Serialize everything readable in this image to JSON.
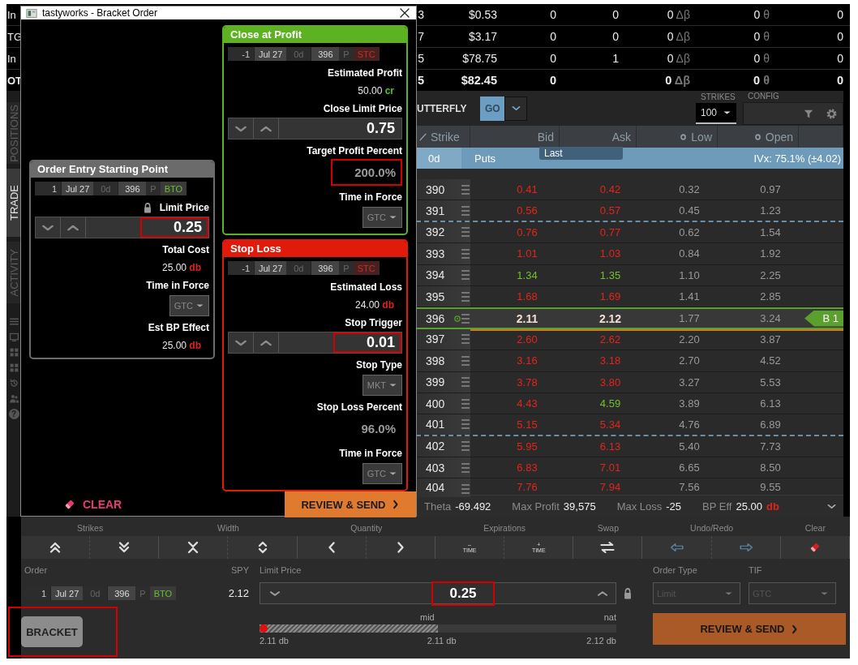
{
  "positions_table": {
    "rows": [
      {
        "column_1": "In",
        "column_2": "3",
        "price": "$0.53",
        "trades": "0",
        "counter": "0",
        "beta_delta": "0",
        "beta_symbol": "Δβ",
        "theta": "0",
        "theta_symbol": "θ",
        "last": "0",
        "total": false
      },
      {
        "column_1": "TG",
        "column_2": "7",
        "price": "$3.17",
        "trades": "0",
        "counter": "0",
        "beta_delta": "0",
        "beta_symbol": "Δβ",
        "theta": "0",
        "theta_symbol": "θ",
        "last": "0",
        "total": false
      },
      {
        "column_1": "In",
        "column_2": "5",
        "price": "$78.75",
        "trades": "0",
        "counter": "1",
        "beta_delta": "0",
        "beta_symbol": "Δβ",
        "theta": "0",
        "theta_symbol": "θ",
        "last": "0",
        "total": false
      },
      {
        "column_1": "OT",
        "column_2": "5",
        "price": "$82.45",
        "trades": "0",
        "beta_delta": "0",
        "beta_symbol": "Δβ",
        "theta": "0",
        "theta_symbol": "θ",
        "last": "0",
        "total": true
      }
    ]
  },
  "sidebar": {
    "tabs": [
      {
        "label": "POSITIONS",
        "selected": false
      },
      {
        "label": "TRADE",
        "selected": true
      },
      {
        "label": "ACTIVITY",
        "selected": false
      }
    ],
    "help": "?"
  },
  "toolbar": {
    "strategy": "UTTERFLY",
    "go": "GO",
    "strikes_label": "STRIKES",
    "strikes_value": "100",
    "config_label": "CONFIG"
  },
  "chain": {
    "columns": [
      "Strike",
      "Bid",
      "Ask",
      "Low",
      "Open"
    ],
    "expiry_bar": {
      "dte": "0d",
      "side": "Puts",
      "tab": "Last",
      "ivx": "IVx: 75.1% (±4.02)"
    },
    "rows": [
      {
        "strike": "390",
        "bid": {
          "value": "0.41",
          "color": "#e0261b"
        },
        "ask": {
          "value": "0.42",
          "color": "#e0261b"
        },
        "low": "0.32",
        "open": "0.97",
        "selected": false,
        "boundary": false
      },
      {
        "strike": "391",
        "bid": {
          "value": "0.56",
          "color": "#e0261b"
        },
        "ask": {
          "value": "0.57",
          "color": "#e0261b"
        },
        "low": "0.45",
        "open": "1.23",
        "selected": false,
        "boundary": true
      },
      {
        "strike": "392",
        "bid": {
          "value": "0.76",
          "color": "#e0261b"
        },
        "ask": {
          "value": "0.77",
          "color": "#e0261b"
        },
        "low": "0.62",
        "open": "1.54",
        "selected": false,
        "boundary": false
      },
      {
        "strike": "393",
        "bid": {
          "value": "1.01",
          "color": "#e0261b"
        },
        "ask": {
          "value": "1.03",
          "color": "#e0261b"
        },
        "low": "0.84",
        "open": "1.92",
        "selected": false,
        "boundary": false
      },
      {
        "strike": "394",
        "bid": {
          "value": "1.34",
          "color": "#72c12c"
        },
        "ask": {
          "value": "1.35",
          "color": "#72c12c"
        },
        "low": "1.10",
        "open": "2.25",
        "selected": false,
        "boundary": false
      },
      {
        "strike": "395",
        "bid": {
          "value": "1.68",
          "color": "#e0261b"
        },
        "ask": {
          "value": "1.69",
          "color": "#e0261b"
        },
        "low": "1.41",
        "open": "2.85",
        "selected": false,
        "boundary": false
      },
      {
        "strike": "396",
        "bid": {
          "value": "2.11"
        },
        "ask": {
          "value": "2.12"
        },
        "low": "1.77",
        "open": "3.24",
        "selected": true,
        "boundary": false,
        "position": "B 1"
      },
      {
        "strike": "397",
        "bid": {
          "value": "2.60",
          "color": "#e0261b"
        },
        "ask": {
          "value": "2.62",
          "color": "#e0261b"
        },
        "low": "2.20",
        "open": "3.87",
        "selected": false,
        "boundary": false
      },
      {
        "strike": "398",
        "bid": {
          "value": "3.16",
          "color": "#e0261b"
        },
        "ask": {
          "value": "3.18",
          "color": "#e0261b"
        },
        "low": "2.70",
        "open": "4.52",
        "selected": false,
        "boundary": false
      },
      {
        "strike": "399",
        "bid": {
          "value": "3.78",
          "color": "#e0261b"
        },
        "ask": {
          "value": "3.80",
          "color": "#e0261b"
        },
        "low": "3.27",
        "open": "5.53",
        "selected": false,
        "boundary": false
      },
      {
        "strike": "400",
        "bid": {
          "value": "4.43",
          "color": "#e0261b"
        },
        "ask": {
          "value": "4.59",
          "color": "#72c12c"
        },
        "low": "3.89",
        "open": "6.13",
        "selected": false,
        "boundary": false
      },
      {
        "strike": "401",
        "bid": {
          "value": "5.15",
          "color": "#e0261b"
        },
        "ask": {
          "value": "5.34",
          "color": "#e0261b"
        },
        "low": "4.76",
        "open": "6.89",
        "selected": false,
        "boundary": true
      },
      {
        "strike": "402",
        "bid": {
          "value": "5.95",
          "color": "#e0261b"
        },
        "ask": {
          "value": "6.13",
          "color": "#e0261b"
        },
        "low": "5.40",
        "open": "7.73",
        "selected": false,
        "boundary": false
      },
      {
        "strike": "403",
        "bid": {
          "value": "6.83",
          "color": "#e0261b"
        },
        "ask": {
          "value": "7.01",
          "color": "#e0261b"
        },
        "low": "6.65",
        "open": "8.50",
        "selected": false,
        "boundary": false
      },
      {
        "strike": "404",
        "bid": {
          "value": "7.76",
          "color": "#e0261b"
        },
        "ask": {
          "value": "7.94",
          "color": "#e0261b"
        },
        "low": "7.56",
        "open": "9.55",
        "selected": false,
        "boundary": false
      }
    ],
    "summary": [
      {
        "label": "Theta",
        "value": "-69.492"
      },
      {
        "label": "Max Profit",
        "value": "39,575"
      },
      {
        "label": "Max Loss",
        "value": "-25"
      },
      {
        "label": "BP Eff",
        "value": "25.00",
        "unit": {
          "text": "db",
          "color": "#e0241a"
        }
      }
    ]
  },
  "order_bar": {
    "groups": [
      {
        "label": "Strikes",
        "buttons": [
          {
            "kind": "double-up"
          },
          {
            "kind": "double-down"
          }
        ]
      },
      {
        "label": "Width",
        "buttons": [
          {
            "kind": "narrow"
          },
          {
            "kind": "widen"
          }
        ]
      },
      {
        "label": "Quantity",
        "buttons": [
          {
            "kind": "left"
          },
          {
            "kind": "right"
          }
        ]
      },
      {
        "label": "Expirations",
        "buttons": [
          {
            "kind": "time",
            "sign": "–",
            "text": "TIME"
          },
          {
            "kind": "time",
            "sign": "+",
            "text": "TIME"
          }
        ]
      },
      {
        "label": "Swap",
        "buttons": [
          {
            "kind": "swap"
          }
        ]
      },
      {
        "label": "Undo/Redo",
        "buttons": [
          {
            "kind": "undo"
          },
          {
            "kind": "redo"
          }
        ]
      },
      {
        "label": "Clear",
        "buttons": [
          {
            "kind": "erase"
          }
        ]
      }
    ],
    "order_label": "Order",
    "leg": {
      "quantity": "1",
      "expiration": "Jul 27",
      "dte": "0d",
      "strike": "396",
      "type": "P",
      "action": "BTO",
      "kind": "buy"
    },
    "symbol": "SPY",
    "symbol_price": "2.12",
    "limit": {
      "label": "Limit Price",
      "value": "0.25",
      "highlighted": true,
      "locked": true
    },
    "order_type": {
      "label": "Order Type",
      "value": "Limit",
      "disabled": true
    },
    "tif": {
      "label": "TIF",
      "value": "GTC",
      "disabled": true
    },
    "bracket": {
      "label": "BRACKET",
      "highlighted": true
    },
    "slider": {
      "level": 0.5,
      "mid_label": "mid",
      "nat_label": "nat",
      "bid_reading": "2.11 db",
      "mid_reading": "2.11 db",
      "nat_reading": "2.12 db"
    },
    "review": "REVIEW & SEND"
  },
  "dialog": {
    "title": "tastyworks - Bracket Order",
    "left_panels": [
      {
        "title": "Order Entry Starting Point",
        "color": "#6b6b6b",
        "leg": {
          "quantity": "1",
          "expiration": "Jul 27",
          "dte": "0d",
          "strike": "396",
          "type": "P",
          "action": "BTO",
          "kind": "buy"
        },
        "fields": [
          {
            "kind": "stepper",
            "label": "Limit Price",
            "locked": true,
            "value": "0.25",
            "highlighted": true
          },
          {
            "kind": "readout",
            "label": "Total Cost",
            "value": "25.00",
            "unit": {
              "text": "db",
              "color": "#e0241a"
            }
          },
          {
            "kind": "select",
            "label": "Time in Force",
            "value": "GTC"
          },
          {
            "kind": "readout",
            "label": "Est BP Effect",
            "value": "25.00",
            "unit": {
              "text": "db",
              "color": "#e0241a"
            }
          }
        ]
      }
    ],
    "right_panels": [
      {
        "title": "Close at Profit",
        "color": "#5cb221",
        "leg": {
          "quantity": "-1",
          "expiration": "Jul 27",
          "dte": "0d",
          "strike": "396",
          "type": "P",
          "action": "STC",
          "kind": "sell"
        },
        "fields": [
          {
            "kind": "readout",
            "label": "Estimated Profit",
            "value": "50.00",
            "unit": {
              "text": "cr",
              "color": "#5dbb24"
            }
          },
          {
            "kind": "stepper",
            "label": "Close Limit Price",
            "locked": false,
            "value": "0.75",
            "highlighted": false
          },
          {
            "kind": "percent",
            "label": "Target Profit Percent",
            "value": "200.0%",
            "highlighted": true
          },
          {
            "kind": "select",
            "label": "Time in Force",
            "value": "GTC"
          }
        ]
      },
      {
        "title": "Stop Loss",
        "color": "#e01b0b",
        "leg": {
          "quantity": "-1",
          "expiration": "Jul 27",
          "dte": "0d",
          "strike": "396",
          "type": "P",
          "action": "STC",
          "kind": "sell"
        },
        "fields": [
          {
            "kind": "readout",
            "label": "Estimated Loss",
            "value": "24.00",
            "unit": {
              "text": "db",
              "color": "#e0241a"
            }
          },
          {
            "kind": "stepper",
            "label": "Stop Trigger",
            "locked": false,
            "value": "0.01",
            "highlighted": true
          },
          {
            "kind": "select",
            "label": "Stop Type",
            "value": "MKT"
          },
          {
            "kind": "percent",
            "label": "Stop Loss Percent",
            "value": "96.0%",
            "highlighted": false
          },
          {
            "kind": "select",
            "label": "Time in Force",
            "value": "GTC"
          }
        ]
      }
    ],
    "clear": "CLEAR",
    "review": "REVIEW & SEND"
  }
}
